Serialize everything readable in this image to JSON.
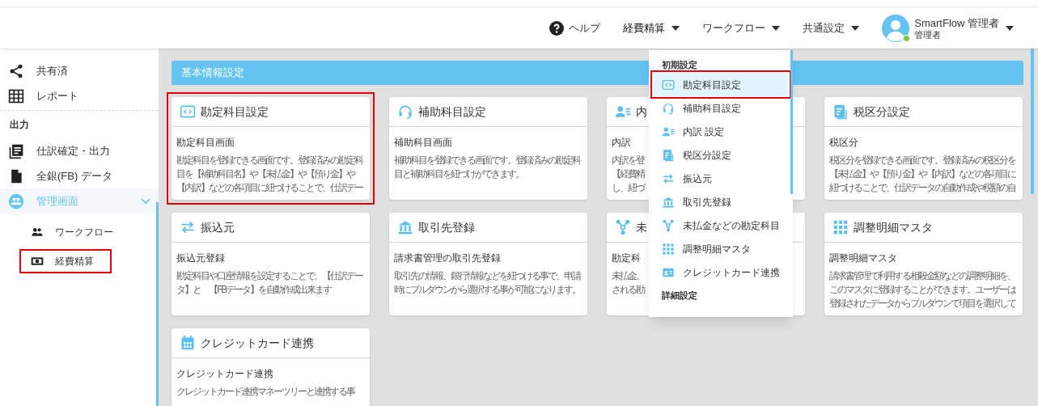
{
  "header": {
    "help": "ヘルプ",
    "menus": [
      {
        "label": "経費精算",
        "expanded": true
      },
      {
        "label": "ワークフロー",
        "expanded": false
      },
      {
        "label": "共通設定",
        "expanded": false
      }
    ],
    "user": {
      "name": "SmartFlow 管理者",
      "role": "管理者",
      "online": true
    }
  },
  "sidebar": {
    "items": [
      {
        "kind": "item",
        "label": "共有済",
        "selected": false
      },
      {
        "kind": "item",
        "label": "レポート",
        "selected": false
      },
      {
        "kind": "heading",
        "label": "出力"
      },
      {
        "kind": "item",
        "label": "仕訳確定・出力",
        "selected": false
      },
      {
        "kind": "item",
        "label": "全銀(FB) データ",
        "selected": false
      },
      {
        "kind": "group",
        "label": "管理画面",
        "selected": true,
        "expanded": true,
        "children": [
          {
            "kind": "sub",
            "label": "ワークフロー",
            "selected": false,
            "highlighted": false
          },
          {
            "kind": "sub",
            "label": "経費精算",
            "selected": false,
            "highlighted": true
          }
        ]
      }
    ]
  },
  "section_title": "基本情報設定",
  "cards": [
    {
      "title": "勘定科目設定",
      "subtitle": "勘定科目画面",
      "description": [
        "勘定科目を登録できる画面です。登録済みの勘定科",
        "目を【補助科目名】や【未払金】や【預り金】や",
        "【内訳】などの各項目に紐づけることで、仕訳デー"
      ],
      "highlighted": true
    },
    {
      "title": "補助科目設定",
      "subtitle": "補助科目画面",
      "description": [
        "補助科目を登録できる画面です。登録済みの勘定科",
        "目と補助科目を紐づけができます。"
      ],
      "highlighted": false
    },
    {
      "title": "内",
      "subtitle": "内訳",
      "description": [
        "内訳を登",
        "【経費精",
        "し、紐づ"
      ],
      "highlighted": false
    },
    {
      "title": "税区分設定",
      "subtitle": "税区分",
      "description": [
        "税区分を登録できる画面です。登録済みの税区分を",
        "【未払金】や【預り金】や【内訳】などの各項目に",
        "紐づけることで、仕訳データの自動作成や税額の自"
      ],
      "highlighted": false
    },
    {
      "title": "振込元",
      "subtitle": "振込元登録",
      "description": [
        "勘定科目や口座情報を設定することで、【仕訳デー",
        "タ】と　【FBデータ】を自動作成出来ます"
      ],
      "highlighted": false
    },
    {
      "title": "取引先登録",
      "subtitle": "請求書管理の取引先登録",
      "description": [
        "取引先の情報、銀行情報などを紐つける事で、申請",
        "時にプルダウンから選択する事が可能になります。"
      ],
      "highlighted": false
    },
    {
      "title": "未",
      "subtitle": "勘定科",
      "description": [
        "未払金、",
        "される勘"
      ],
      "highlighted": false
    },
    {
      "title": "調整明細マスタ",
      "subtitle": "調整明細マスタ",
      "description": [
        "請求書管理で利用する相殺金額などの調整明細を、",
        "このマスタに登録することができます。ユーザーは",
        "登録されたデータからプルダウンで項目を選択して"
      ],
      "highlighted": false
    },
    {
      "title": "クレジットカード連携",
      "subtitle": "クレジットカード連携",
      "description": [
        "クレジットカード連携マネーツリーと連携する事"
      ],
      "highlighted": false
    }
  ],
  "dropdown": {
    "items": [
      {
        "kind": "heading",
        "label": "初期設定"
      },
      {
        "kind": "item",
        "label": "勘定科目設定",
        "selected": true,
        "highlighted": true
      },
      {
        "kind": "item",
        "label": "補助科目設定",
        "selected": false,
        "highlighted": false
      },
      {
        "kind": "item",
        "label": "内訳 設定",
        "selected": false,
        "highlighted": false
      },
      {
        "kind": "item",
        "label": "税区分設定",
        "selected": false,
        "highlighted": false
      },
      {
        "kind": "item",
        "label": "振込元",
        "selected": false,
        "highlighted": false
      },
      {
        "kind": "item",
        "label": "取引先登録",
        "selected": false,
        "highlighted": false
      },
      {
        "kind": "item",
        "label": "未払金などの勘定科目",
        "selected": false,
        "highlighted": false
      },
      {
        "kind": "item",
        "label": "調整明細マスタ",
        "selected": false,
        "highlighted": false
      },
      {
        "kind": "item",
        "label": "クレジットカード連携",
        "selected": false,
        "highlighted": false
      },
      {
        "kind": "heading",
        "label": "詳細設定"
      }
    ]
  }
}
